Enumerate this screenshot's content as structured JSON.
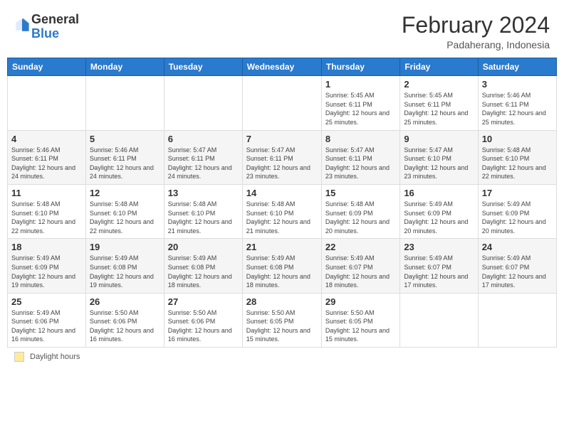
{
  "header": {
    "logo_line1": "General",
    "logo_line2": "Blue",
    "month_year": "February 2024",
    "location": "Padaherang, Indonesia"
  },
  "days_of_week": [
    "Sunday",
    "Monday",
    "Tuesday",
    "Wednesday",
    "Thursday",
    "Friday",
    "Saturday"
  ],
  "weeks": [
    [
      {
        "day": "",
        "info": ""
      },
      {
        "day": "",
        "info": ""
      },
      {
        "day": "",
        "info": ""
      },
      {
        "day": "",
        "info": ""
      },
      {
        "day": "1",
        "info": "Sunrise: 5:45 AM\nSunset: 6:11 PM\nDaylight: 12 hours and 25 minutes."
      },
      {
        "day": "2",
        "info": "Sunrise: 5:45 AM\nSunset: 6:11 PM\nDaylight: 12 hours and 25 minutes."
      },
      {
        "day": "3",
        "info": "Sunrise: 5:46 AM\nSunset: 6:11 PM\nDaylight: 12 hours and 25 minutes."
      }
    ],
    [
      {
        "day": "4",
        "info": "Sunrise: 5:46 AM\nSunset: 6:11 PM\nDaylight: 12 hours and 24 minutes."
      },
      {
        "day": "5",
        "info": "Sunrise: 5:46 AM\nSunset: 6:11 PM\nDaylight: 12 hours and 24 minutes."
      },
      {
        "day": "6",
        "info": "Sunrise: 5:47 AM\nSunset: 6:11 PM\nDaylight: 12 hours and 24 minutes."
      },
      {
        "day": "7",
        "info": "Sunrise: 5:47 AM\nSunset: 6:11 PM\nDaylight: 12 hours and 23 minutes."
      },
      {
        "day": "8",
        "info": "Sunrise: 5:47 AM\nSunset: 6:11 PM\nDaylight: 12 hours and 23 minutes."
      },
      {
        "day": "9",
        "info": "Sunrise: 5:47 AM\nSunset: 6:10 PM\nDaylight: 12 hours and 23 minutes."
      },
      {
        "day": "10",
        "info": "Sunrise: 5:48 AM\nSunset: 6:10 PM\nDaylight: 12 hours and 22 minutes."
      }
    ],
    [
      {
        "day": "11",
        "info": "Sunrise: 5:48 AM\nSunset: 6:10 PM\nDaylight: 12 hours and 22 minutes."
      },
      {
        "day": "12",
        "info": "Sunrise: 5:48 AM\nSunset: 6:10 PM\nDaylight: 12 hours and 22 minutes."
      },
      {
        "day": "13",
        "info": "Sunrise: 5:48 AM\nSunset: 6:10 PM\nDaylight: 12 hours and 21 minutes."
      },
      {
        "day": "14",
        "info": "Sunrise: 5:48 AM\nSunset: 6:10 PM\nDaylight: 12 hours and 21 minutes."
      },
      {
        "day": "15",
        "info": "Sunrise: 5:48 AM\nSunset: 6:09 PM\nDaylight: 12 hours and 20 minutes."
      },
      {
        "day": "16",
        "info": "Sunrise: 5:49 AM\nSunset: 6:09 PM\nDaylight: 12 hours and 20 minutes."
      },
      {
        "day": "17",
        "info": "Sunrise: 5:49 AM\nSunset: 6:09 PM\nDaylight: 12 hours and 20 minutes."
      }
    ],
    [
      {
        "day": "18",
        "info": "Sunrise: 5:49 AM\nSunset: 6:09 PM\nDaylight: 12 hours and 19 minutes."
      },
      {
        "day": "19",
        "info": "Sunrise: 5:49 AM\nSunset: 6:08 PM\nDaylight: 12 hours and 19 minutes."
      },
      {
        "day": "20",
        "info": "Sunrise: 5:49 AM\nSunset: 6:08 PM\nDaylight: 12 hours and 18 minutes."
      },
      {
        "day": "21",
        "info": "Sunrise: 5:49 AM\nSunset: 6:08 PM\nDaylight: 12 hours and 18 minutes."
      },
      {
        "day": "22",
        "info": "Sunrise: 5:49 AM\nSunset: 6:07 PM\nDaylight: 12 hours and 18 minutes."
      },
      {
        "day": "23",
        "info": "Sunrise: 5:49 AM\nSunset: 6:07 PM\nDaylight: 12 hours and 17 minutes."
      },
      {
        "day": "24",
        "info": "Sunrise: 5:49 AM\nSunset: 6:07 PM\nDaylight: 12 hours and 17 minutes."
      }
    ],
    [
      {
        "day": "25",
        "info": "Sunrise: 5:49 AM\nSunset: 6:06 PM\nDaylight: 12 hours and 16 minutes."
      },
      {
        "day": "26",
        "info": "Sunrise: 5:50 AM\nSunset: 6:06 PM\nDaylight: 12 hours and 16 minutes."
      },
      {
        "day": "27",
        "info": "Sunrise: 5:50 AM\nSunset: 6:06 PM\nDaylight: 12 hours and 16 minutes."
      },
      {
        "day": "28",
        "info": "Sunrise: 5:50 AM\nSunset: 6:05 PM\nDaylight: 12 hours and 15 minutes."
      },
      {
        "day": "29",
        "info": "Sunrise: 5:50 AM\nSunset: 6:05 PM\nDaylight: 12 hours and 15 minutes."
      },
      {
        "day": "",
        "info": ""
      },
      {
        "day": "",
        "info": ""
      }
    ]
  ],
  "footer": {
    "daylight_label": "Daylight hours"
  }
}
